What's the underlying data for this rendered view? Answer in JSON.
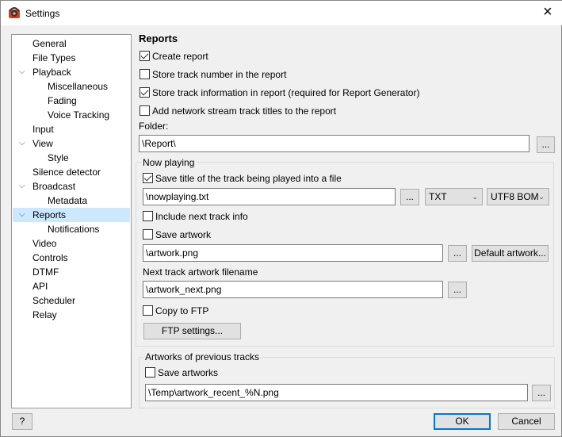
{
  "window": {
    "title": "Settings",
    "close_icon": "×"
  },
  "tree": [
    {
      "label": "General",
      "level": 0
    },
    {
      "label": "File Types",
      "level": 0
    },
    {
      "label": "Playback",
      "level": 0,
      "expanded": true
    },
    {
      "label": "Miscellaneous",
      "level": 1
    },
    {
      "label": "Fading",
      "level": 1
    },
    {
      "label": "Voice Tracking",
      "level": 1
    },
    {
      "label": "Input",
      "level": 0
    },
    {
      "label": "View",
      "level": 0,
      "expanded": true
    },
    {
      "label": "Style",
      "level": 1
    },
    {
      "label": "Silence detector",
      "level": 0
    },
    {
      "label": "Broadcast",
      "level": 0,
      "expanded": true
    },
    {
      "label": "Metadata",
      "level": 1
    },
    {
      "label": "Reports",
      "level": 0,
      "expanded": true,
      "selected": true
    },
    {
      "label": "Notifications",
      "level": 1
    },
    {
      "label": "Video",
      "level": 0
    },
    {
      "label": "Controls",
      "level": 0
    },
    {
      "label": "DTMF",
      "level": 0
    },
    {
      "label": "API",
      "level": 0
    },
    {
      "label": "Scheduler",
      "level": 0
    },
    {
      "label": "Relay",
      "level": 0
    }
  ],
  "reports": {
    "heading": "Reports",
    "create_report": {
      "label": "Create report",
      "checked": true
    },
    "store_track_number": {
      "label": "Store track number in the report",
      "checked": false
    },
    "store_track_info": {
      "label": "Store track information in report (required for Report Generator)",
      "checked": true
    },
    "add_network_titles": {
      "label": "Add network stream track titles to the report",
      "checked": false
    },
    "folder_label": "Folder:",
    "folder_value": "\\Report\\",
    "browse": "..."
  },
  "now_playing": {
    "title": "Now playing",
    "save_title": {
      "label": "Save title of the track being played into a file",
      "checked": true
    },
    "file_value": "\\nowplaying.txt",
    "format": "TXT",
    "encoding": "UTF8 BOM",
    "include_next": {
      "label": "Include next track info",
      "checked": false
    },
    "save_artwork": {
      "label": "Save artwork",
      "checked": false
    },
    "artwork_value": "\\artwork.png",
    "default_artwork": "Default artwork...",
    "next_artwork_label": "Next track artwork filename",
    "next_artwork_value": "\\artwork_next.png",
    "copy_ftp": {
      "label": "Copy to FTP",
      "checked": false
    },
    "ftp_settings": "FTP settings..."
  },
  "previous": {
    "title": "Artworks of previous tracks",
    "save_artworks": {
      "label": "Save artworks",
      "checked": false
    },
    "value": "\\Temp\\artwork_recent_%N.png"
  },
  "footer": {
    "help": "?",
    "ok": "OK",
    "cancel": "Cancel"
  },
  "colors": {
    "selection": "#cce8ff",
    "ok_border": "#0078d7"
  }
}
